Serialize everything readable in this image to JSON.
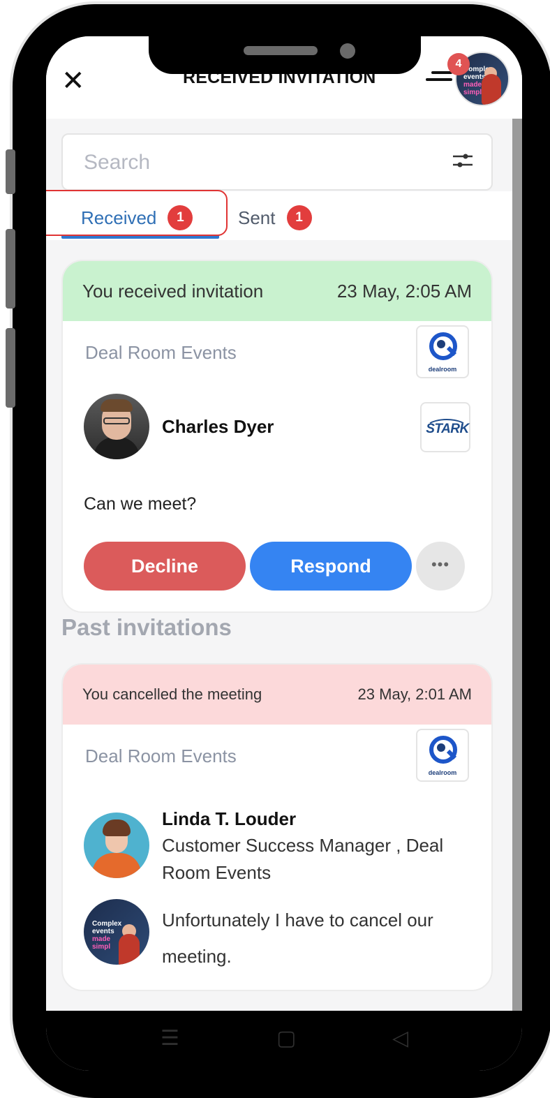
{
  "header": {
    "title": "RECEIVED INVITATION",
    "close_icon": "close-icon",
    "menu_icon": "hamburger-icon",
    "notification_count": "4",
    "avatar_text_1": "Complex",
    "avatar_text_2": "events",
    "avatar_text_3": "made",
    "avatar_text_4": "simpl"
  },
  "search": {
    "placeholder": "Search",
    "filter_icon": "filter-sliders-icon"
  },
  "tabs": [
    {
      "label": "Received",
      "count": "1",
      "active": true
    },
    {
      "label": "Sent",
      "count": "1",
      "active": false
    }
  ],
  "current_invitation": {
    "status_text": "You received invitation",
    "timestamp": "23 May, 2:05 AM",
    "status_color": "#c9f2cf",
    "organization": "Deal Room Events",
    "org_logo_label": "dealroom",
    "sender_name": "Charles Dyer",
    "company_logo_label": "STARK",
    "message": "Can we meet?",
    "decline_label": "Decline",
    "respond_label": "Respond",
    "more_label": "•••"
  },
  "past_section_title": "Past invitations",
  "past_invitation": {
    "status_text": "You cancelled the meeting",
    "timestamp": "23 May, 2:01 AM",
    "status_color": "#fcd9da",
    "organization": "Deal Room Events",
    "org_logo_label": "dealroom",
    "person_name": "Linda T. Louder",
    "person_title": "Customer Success Manager , Deal Room Events",
    "message": "Unfortunately I have to cancel our meeting.",
    "message_avatar_text_1": "Complex",
    "message_avatar_text_2": "events",
    "message_avatar_text_3": "made",
    "message_avatar_text_4": "simpl"
  },
  "navbar": {
    "menu_icon": "recent-apps-icon",
    "home_icon": "home-icon",
    "back_icon": "back-icon"
  },
  "colors": {
    "accent_blue": "#3584f2",
    "decline_red": "#db5b5b",
    "badge_red": "#e23d3d",
    "tab_active": "#2f6fb5"
  }
}
